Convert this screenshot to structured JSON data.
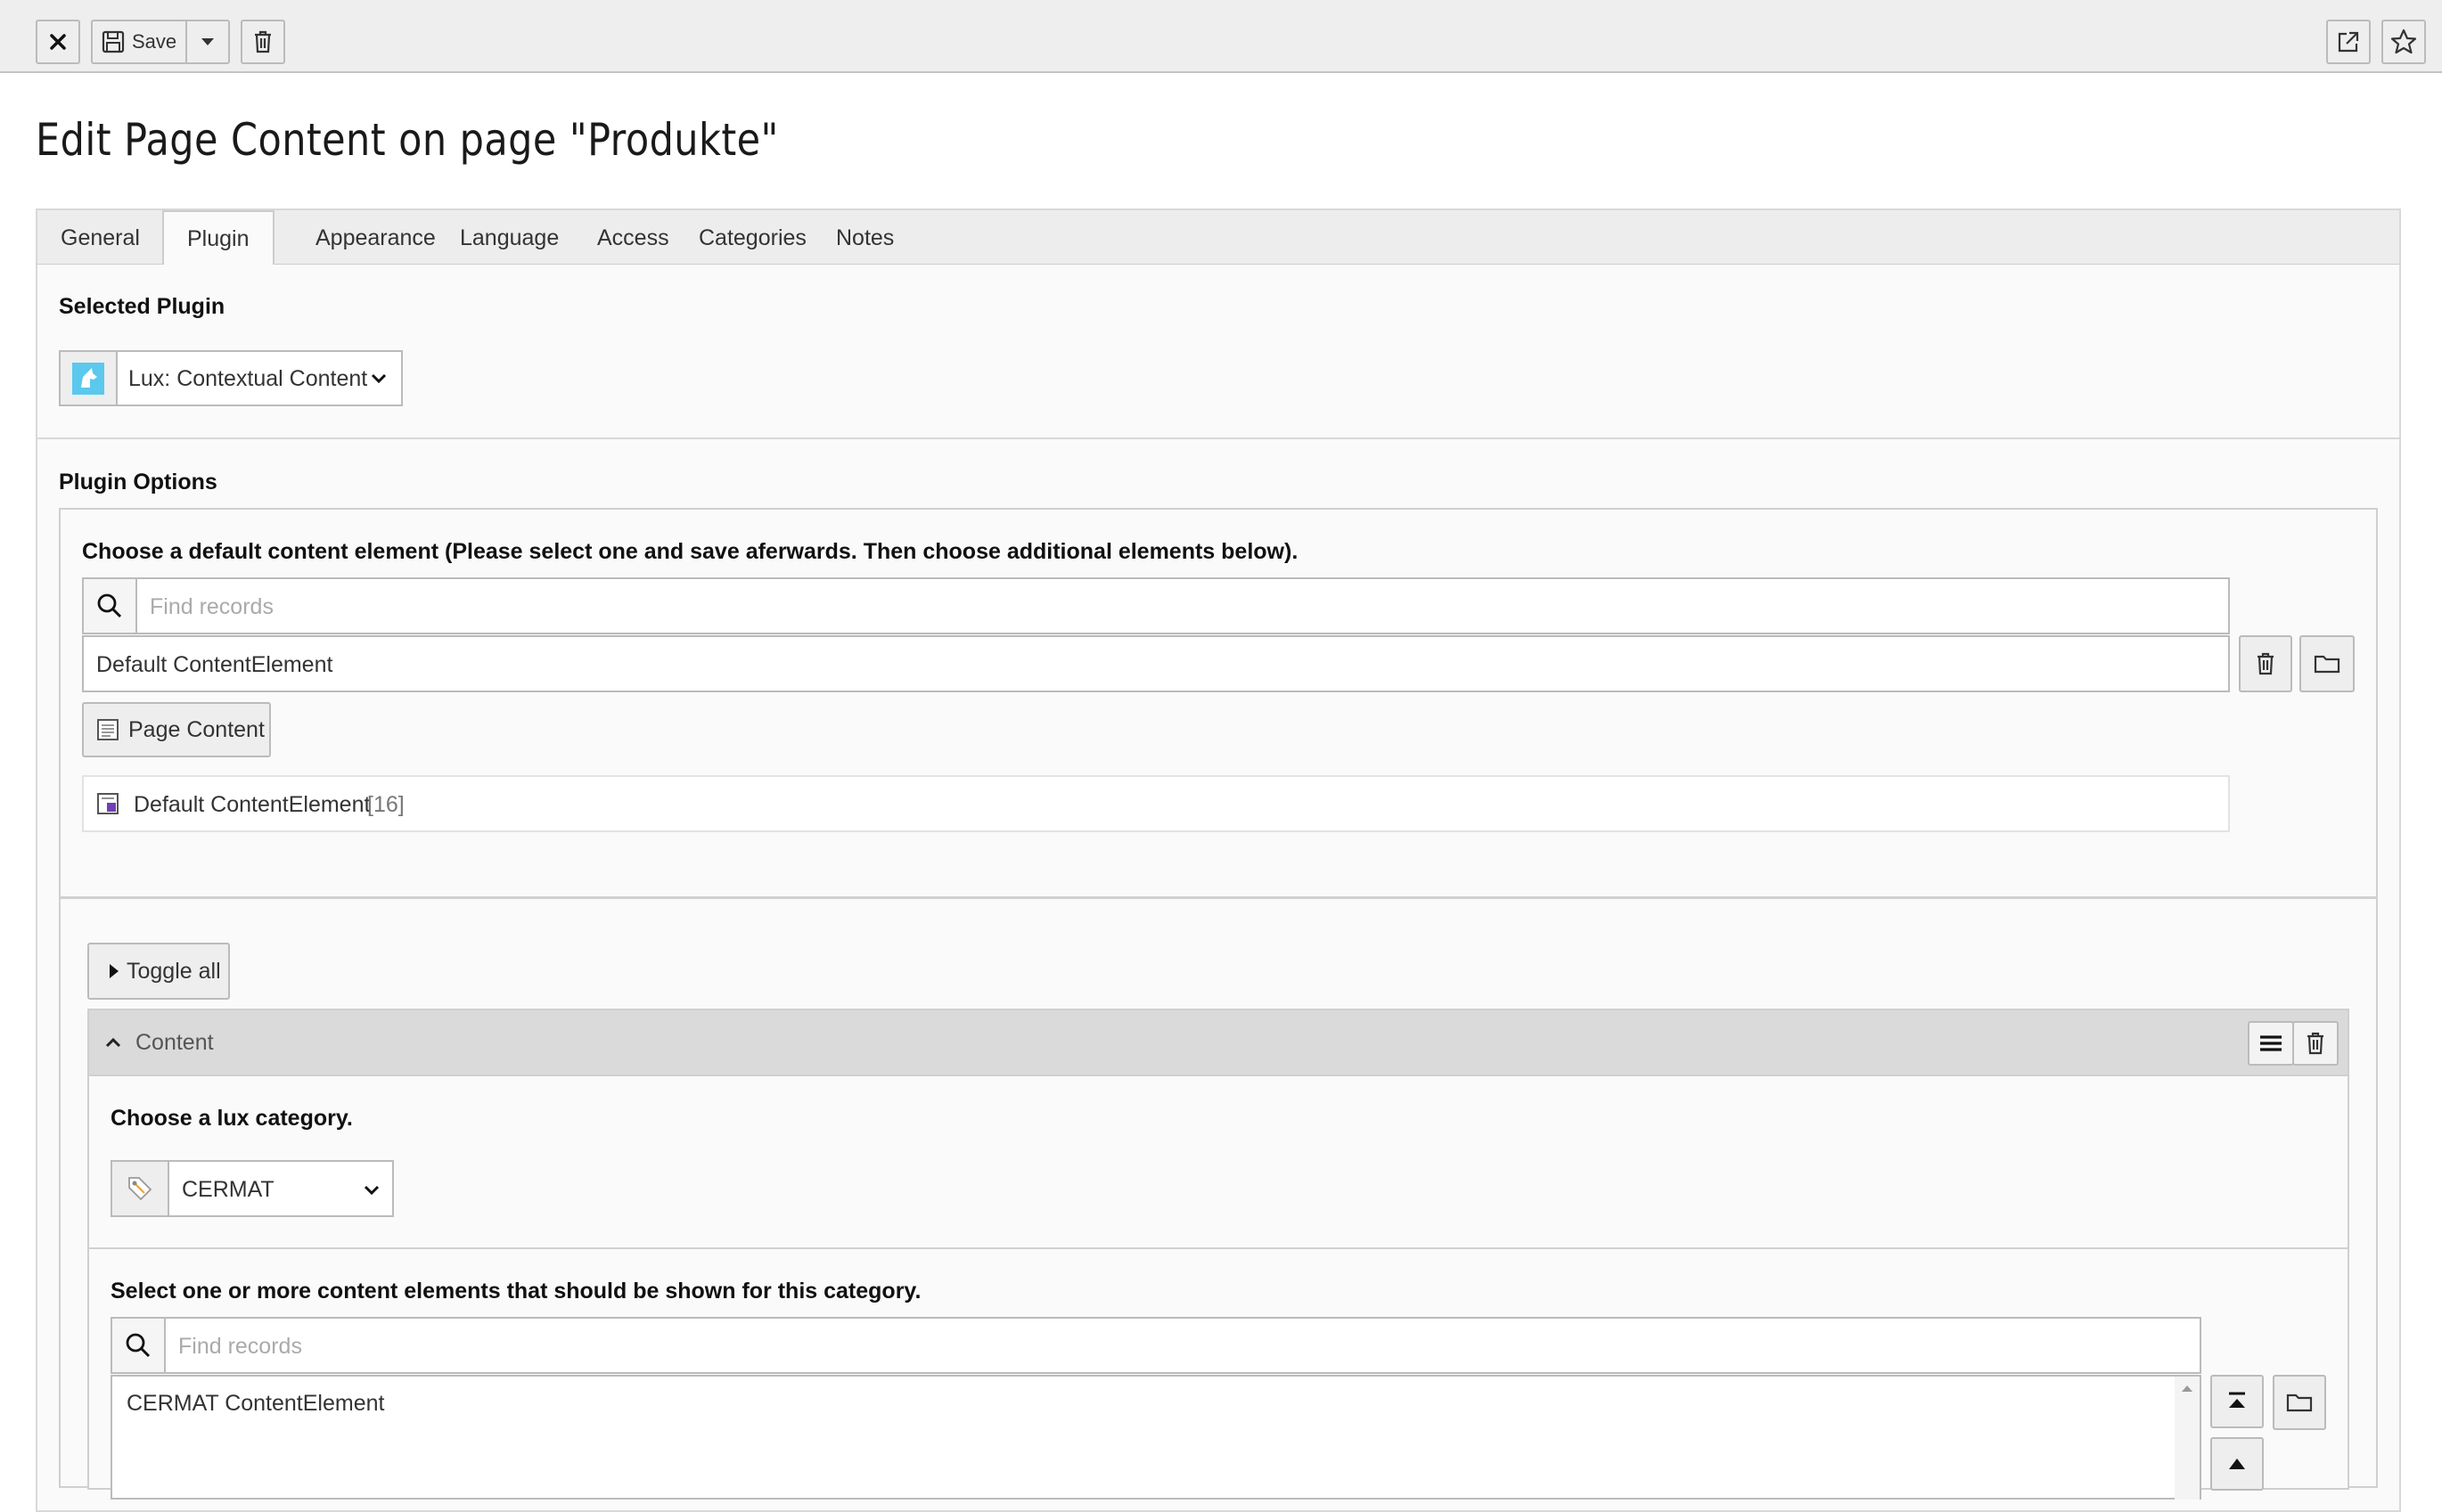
{
  "toolbar": {
    "save_label": "Save"
  },
  "page": {
    "title": "Edit Page Content on page \"Produkte\""
  },
  "tabs": [
    {
      "label": "General"
    },
    {
      "label": "Plugin"
    },
    {
      "label": "Appearance"
    },
    {
      "label": "Language"
    },
    {
      "label": "Access"
    },
    {
      "label": "Categories"
    },
    {
      "label": "Notes"
    }
  ],
  "plugin": {
    "section_label": "Selected Plugin",
    "selected_value": "Lux: Contextual Content"
  },
  "options": {
    "section_label": "Plugin Options",
    "default_label": "Choose a default content element (Please select one and save aferwards. Then choose additional elements below).",
    "search_placeholder": "Find records",
    "selected_item": "Default ContentElement",
    "page_content_button": "Page Content",
    "record_title": "Default ContentElement",
    "record_uid": "[16]"
  },
  "toggle_all_label": "Toggle all",
  "content_panel": {
    "header_label": "Content",
    "category_label": "Choose a lux category.",
    "category_value": "CERMAT",
    "elements_label": "Select one or more content elements that should be shown for this category.",
    "search_placeholder": "Find records",
    "selected_item": "CERMAT ContentElement"
  }
}
